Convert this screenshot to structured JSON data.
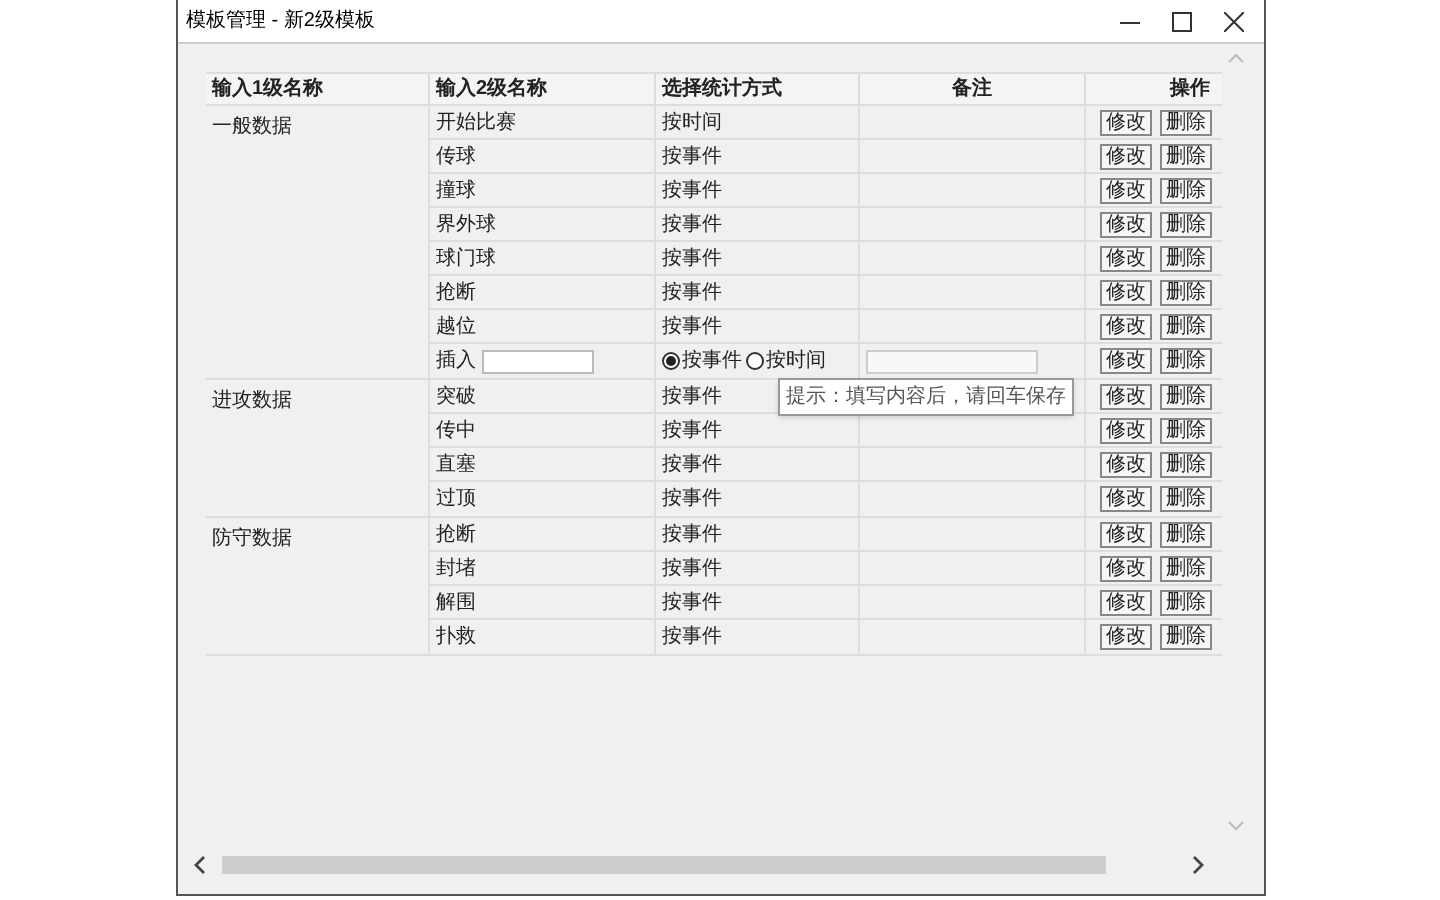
{
  "window": {
    "title": "模板管理 -  新2级模板"
  },
  "table": {
    "columns": [
      "输入1级名称",
      "输入2级名称",
      "选择统计方式",
      "备注",
      "操作"
    ],
    "groups": [
      {
        "name": "一般数据",
        "rows": [
          {
            "kind": "item",
            "name": "开始比赛",
            "method": "按时间",
            "actions": [
              "修改",
              "删除"
            ]
          },
          {
            "kind": "item",
            "name": "传球",
            "method": "按事件",
            "actions": [
              "修改",
              "删除"
            ]
          },
          {
            "kind": "item",
            "name": "撞球",
            "method": "按事件",
            "actions": [
              "修改",
              "删除"
            ]
          },
          {
            "kind": "item",
            "name": "界外球",
            "method": "按事件",
            "actions": [
              "修改",
              "删除"
            ]
          },
          {
            "kind": "item",
            "name": "球门球",
            "method": "按事件",
            "actions": [
              "修改",
              "删除"
            ]
          },
          {
            "kind": "item",
            "name": "抢断",
            "method": "按事件",
            "actions": [
              "修改",
              "删除"
            ]
          },
          {
            "kind": "item",
            "name": "越位",
            "method": "按事件",
            "actions": [
              "修改",
              "删除"
            ]
          },
          {
            "kind": "new",
            "label": "插入",
            "options": [
              {
                "label": "按事件",
                "selected": true
              },
              {
                "label": "按时间",
                "selected": false
              }
            ],
            "actions": [
              "修改",
              "删除"
            ]
          }
        ]
      },
      {
        "name": "进攻数据",
        "rows": [
          {
            "kind": "item",
            "name": "突破",
            "method": "按事件",
            "actions": [
              "修改",
              "删除"
            ]
          },
          {
            "kind": "item",
            "name": "传中",
            "method": "按事件",
            "actions": [
              "修改",
              "删除"
            ]
          },
          {
            "kind": "item",
            "name": "直塞",
            "method": "按事件",
            "actions": [
              "修改",
              "删除"
            ]
          },
          {
            "kind": "item",
            "name": "过顶",
            "method": "按事件",
            "actions": [
              "修改",
              "删除"
            ]
          }
        ]
      },
      {
        "name": "防守数据",
        "rows": [
          {
            "kind": "item",
            "name": "抢断",
            "method": "按事件",
            "actions": [
              "修改",
              "删除"
            ]
          },
          {
            "kind": "item",
            "name": "封堵",
            "method": "按事件",
            "actions": [
              "修改",
              "删除"
            ]
          },
          {
            "kind": "item",
            "name": "解围",
            "method": "按事件",
            "actions": [
              "修改",
              "删除"
            ]
          },
          {
            "kind": "item",
            "name": "扑救",
            "method": "按事件",
            "actions": [
              "修改",
              "删除"
            ]
          }
        ]
      }
    ]
  },
  "tooltip": {
    "text": "提示：填写内容后，请回车保存"
  }
}
